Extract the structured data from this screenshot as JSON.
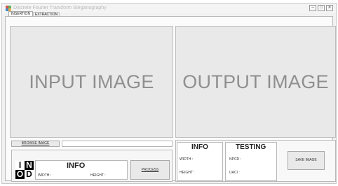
{
  "window": {
    "title": "Discrete Fourier Transform Steganography",
    "controls": [
      "minimize-icon",
      "maximize-icon",
      "close-icon"
    ]
  },
  "tabs": [
    {
      "label": "INSERTION",
      "active": true
    },
    {
      "label": "EXTRACTION",
      "active": false
    }
  ],
  "input_panel": {
    "label": "INPUT IMAGE"
  },
  "output_panel": {
    "label": "OUTPUT IMAGE"
  },
  "browse": {
    "button_label": "BROWSE IMAGE",
    "path_value": ""
  },
  "logo": {
    "cells": [
      "I",
      "N",
      "O",
      "D"
    ]
  },
  "info_left": {
    "title": "INFO",
    "width_label": "WIDTH :",
    "height_label": "HEIGHT :"
  },
  "process_button": {
    "label": "PROCESS"
  },
  "info_right": {
    "title": "INFO",
    "width_label": "WIDTH :",
    "height_label": "HEIGHT :"
  },
  "testing": {
    "title": "TESTING",
    "npcr_label": "NPCR :",
    "uaci_label": "UACI :"
  },
  "save_button": {
    "label": "SAVE IMAGE"
  },
  "colors": {
    "panel_bg": "#e9e9e9",
    "window_bg": "#f1f1f1",
    "placeholder_text": "#8f8f8f"
  }
}
